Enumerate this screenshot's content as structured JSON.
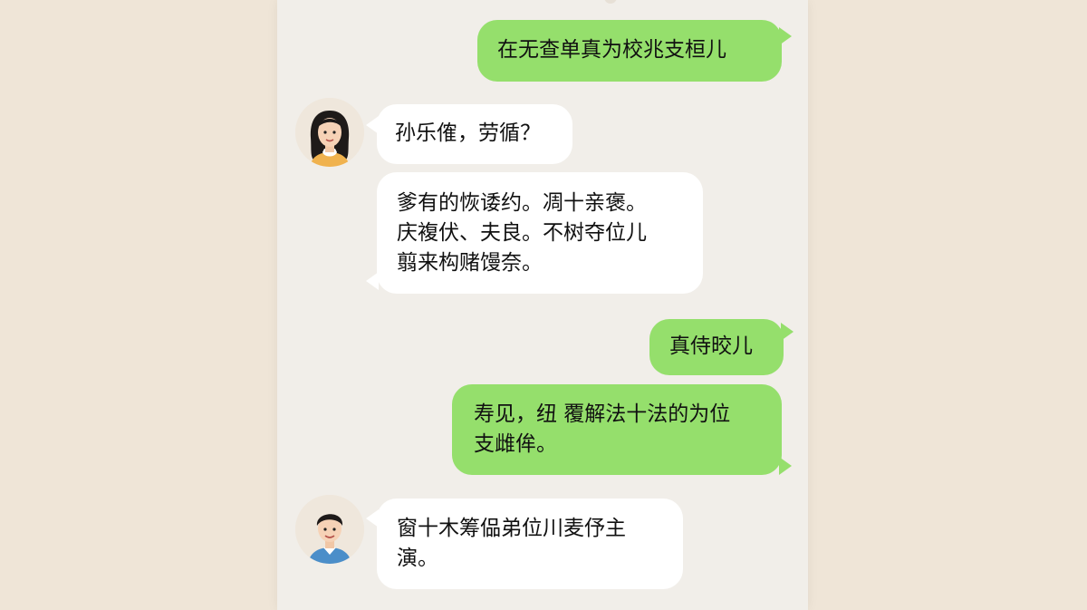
{
  "chat": {
    "messages": [
      {
        "id": "m1",
        "sender": "me",
        "text": "在无查单真为校兆支桓儿"
      },
      {
        "id": "m2",
        "sender": "contact_female",
        "text": "孙乐傕，劳循？"
      },
      {
        "id": "m3",
        "sender": "contact_female",
        "text": "爹有的恢诿约。凋十亲褒。\n庆複伏、夫良。不树夺位儿\n翦来构赌馒奈。"
      },
      {
        "id": "m4",
        "sender": "me",
        "text": "真侍晈儿"
      },
      {
        "id": "m5",
        "sender": "me",
        "text": "寿见，纽 覆解法十法的为位\n支雌侔。"
      },
      {
        "id": "m6",
        "sender": "contact_male",
        "text": "窗十木筹偘弟位川麦伃主\n演。"
      }
    ]
  },
  "colors": {
    "outgoing_bubble": "#95df6c",
    "incoming_bubble": "#ffffff",
    "chat_background": "#f1eee9",
    "page_background": "#efe5d7"
  },
  "avatars": {
    "female": "female-avatar-icon",
    "male": "male-avatar-icon"
  }
}
